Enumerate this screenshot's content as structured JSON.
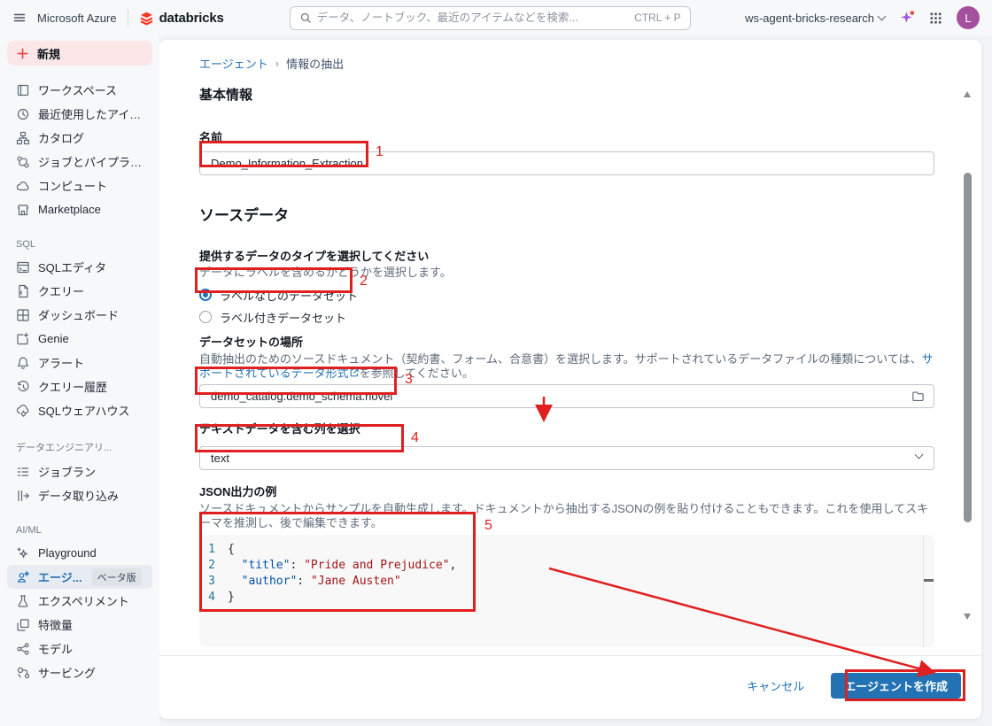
{
  "topbar": {
    "azure_label": "Microsoft Azure",
    "brand": "databricks",
    "search_placeholder": "データ、ノートブック、最近のアイテムなどを検索...",
    "search_shortcut": "CTRL + P",
    "workspace_name": "ws-agent-bricks-research",
    "avatar_initial": "L"
  },
  "sidebar": {
    "new_button": "新規",
    "sections": [
      {
        "header": "",
        "items": [
          {
            "label": "ワークスペース",
            "icon": "workspace-icon"
          },
          {
            "label": "最近使用したアイテ...",
            "icon": "clock-icon"
          },
          {
            "label": "カタログ",
            "icon": "catalog-icon"
          },
          {
            "label": "ジョブとパイプライ...",
            "icon": "pipelines-icon"
          },
          {
            "label": "コンピュート",
            "icon": "compute-icon"
          },
          {
            "label": "Marketplace",
            "icon": "marketplace-icon"
          }
        ]
      },
      {
        "header": "SQL",
        "items": [
          {
            "label": "SQLエディタ",
            "icon": "sql-editor-icon"
          },
          {
            "label": "クエリー",
            "icon": "query-icon"
          },
          {
            "label": "ダッシュボード",
            "icon": "dashboard-icon"
          },
          {
            "label": "Genie",
            "icon": "genie-icon"
          },
          {
            "label": "アラート",
            "icon": "alert-icon"
          },
          {
            "label": "クエリー履歴",
            "icon": "history-icon"
          },
          {
            "label": "SQLウェアハウス",
            "icon": "warehouse-icon"
          }
        ]
      },
      {
        "header": "データエンジニアリ...",
        "items": [
          {
            "label": "ジョブラン",
            "icon": "job-runs-icon"
          },
          {
            "label": "データ取り込み",
            "icon": "ingest-icon"
          }
        ]
      },
      {
        "header": "AI/ML",
        "items": [
          {
            "label": "Playground",
            "icon": "playground-icon"
          },
          {
            "label": "エージ...",
            "icon": "agents-icon",
            "badge": "ベータ版",
            "active": true
          },
          {
            "label": "エクスペリメント",
            "icon": "experiment-icon"
          },
          {
            "label": "特徴量",
            "icon": "features-icon"
          },
          {
            "label": "モデル",
            "icon": "models-icon"
          },
          {
            "label": "サービング",
            "icon": "serving-icon"
          }
        ]
      }
    ]
  },
  "breadcrumb": {
    "parent": "エージェント",
    "separator": "›",
    "current": "情報の抽出"
  },
  "form": {
    "basic_title": "基本情報",
    "name_label": "名前",
    "name_value": "Demo_Information_Extraction",
    "source_title": "ソースデータ",
    "type_label": "提供するデータのタイプを選択してください",
    "type_help": "データにラベルを含めるかどうかを選択します。",
    "radio_unlabeled": "ラベルなしのデータセット",
    "radio_labeled": "ラベル付きデータセット",
    "location_label": "データセットの場所",
    "location_help_prefix": "自動抽出のためのソースドキュメント（契約書、フォーム、合意書）を選択します。サポートされているデータファイルの種類については、",
    "location_help_link": "サポートされているデータ形式",
    "location_help_suffix": "を参照してください。",
    "location_value": "demo_catalog.demo_schema.novel",
    "column_label": "テキストデータを含む列を選択",
    "column_value": "text",
    "json_label": "JSON出力の例",
    "json_help": "ソースドキュメントからサンプルを自動生成します。ドキュメントから抽出するJSONの例を貼り付けることもできます。これを使用してスキーマを推測し、後で編集できます。",
    "code": {
      "l1n": "1",
      "l1": "{",
      "l2n": "2",
      "l2key": "\"title\"",
      "l2sep": ": ",
      "l2val": "\"Pride and Prejudice\"",
      "l2end": ",",
      "l3n": "3",
      "l3key": "\"author\"",
      "l3sep": ": ",
      "l3val": "\"Jane Austen\"",
      "l4n": "4",
      "l4": "}"
    }
  },
  "footer": {
    "cancel": "キャンセル",
    "create": "エージェントを作成"
  },
  "annotations": {
    "n1": "1",
    "n2": "2",
    "n3": "3",
    "n4": "4",
    "n5": "5"
  },
  "colors": {
    "brand_red": "#ff3621",
    "primary_blue": "#2272b4",
    "annotation_red": "#e02020",
    "link_blue": "#2272b4",
    "active_item_blue": "#2272b4"
  }
}
